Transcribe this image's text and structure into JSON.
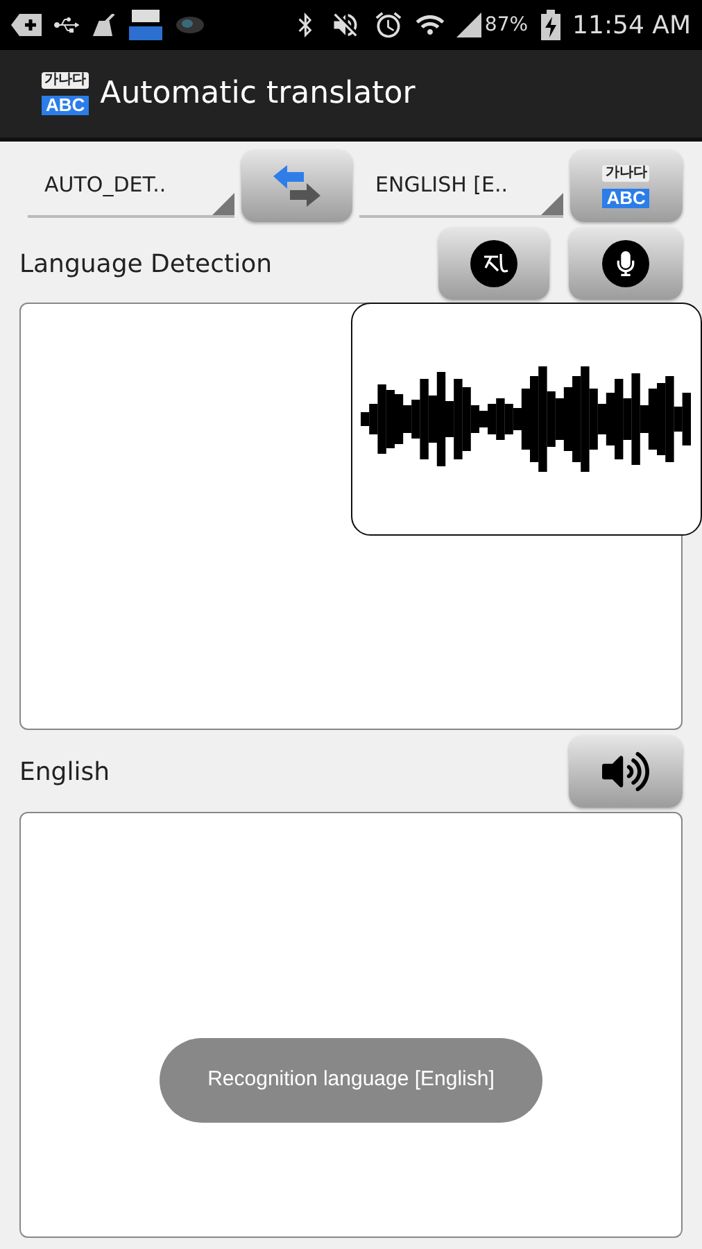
{
  "status_bar": {
    "battery": "87%",
    "time": "11:54 AM"
  },
  "app_bar": {
    "icon_top": "가나다",
    "icon_bottom": "ABC",
    "title": "Automatic translator"
  },
  "source_language": {
    "value": "AUTO_DET.."
  },
  "target_language": {
    "value": "ENGLISH [E.."
  },
  "translate_button": {
    "icon_top": "가나다",
    "icon_bottom": "ABC"
  },
  "source_label": "Language Detection",
  "target_label": "English",
  "toast": "Recognition language [English]"
}
